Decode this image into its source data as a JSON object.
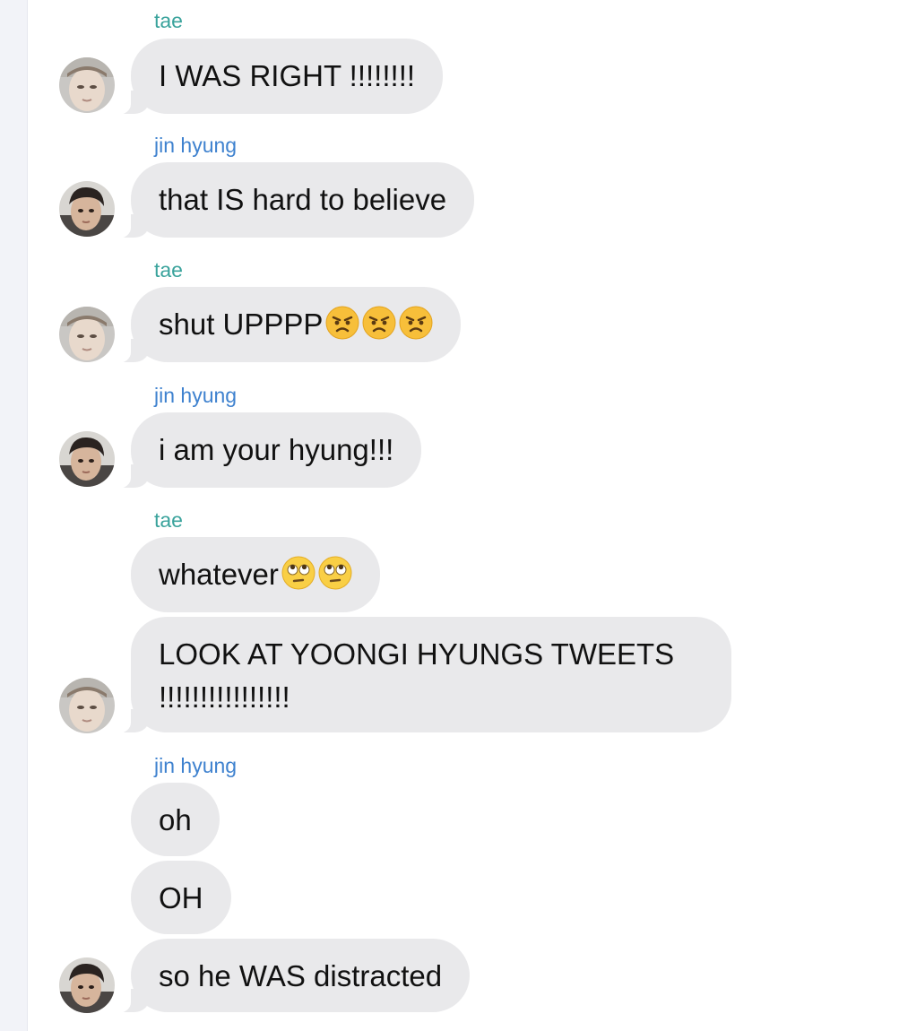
{
  "chat": {
    "participants": {
      "tae": {
        "name": "tae",
        "color": "#3aa39c"
      },
      "jin": {
        "name": "jin hyung",
        "color": "#3f82cf"
      }
    },
    "bubble_color": "#e9e9eb",
    "groups": [
      {
        "sender": "tae",
        "messages": [
          "I WAS RIGHT !!!!!!!!"
        ]
      },
      {
        "sender": "jin hyung",
        "messages": [
          "that IS hard to believe"
        ]
      },
      {
        "sender": "tae",
        "messages": [
          {
            "text": "shut UPPPP",
            "emoji": [
              "angry-face",
              "angry-face",
              "angry-face"
            ]
          }
        ]
      },
      {
        "sender": "jin hyung",
        "messages": [
          "i am your hyung!!!"
        ]
      },
      {
        "sender": "tae",
        "messages": [
          {
            "text": "whatever",
            "emoji": [
              "eye-roll-face",
              "eye-roll-face"
            ]
          },
          "LOOK AT YOONGI HYUNGS TWEETS !!!!!!!!!!!!!!!!"
        ]
      },
      {
        "sender": "jin hyung",
        "messages": [
          "oh",
          "OH",
          "so he WAS distracted"
        ]
      }
    ]
  }
}
